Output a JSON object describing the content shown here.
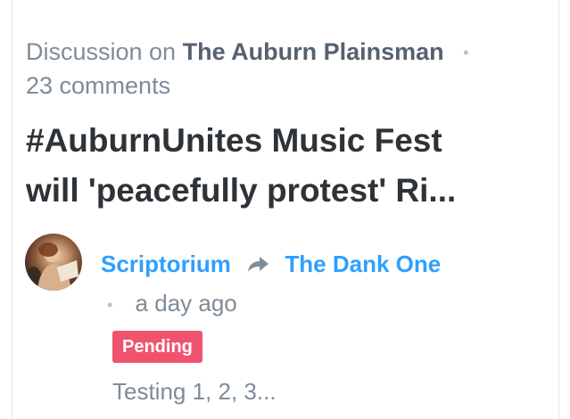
{
  "discussion": {
    "prefix": "Discussion on",
    "forum_name": "The Auburn Plainsman",
    "separator": "•",
    "comment_count": "23 comments"
  },
  "thread": {
    "title_line1": "#AuburnUnites Music Fest",
    "title_line2": "will 'peacefully protest' Ri..."
  },
  "comment": {
    "author": "Scriptorium",
    "reply_icon": "reply-arrow-icon",
    "reply_to": "The Dank One",
    "separator": "•",
    "timestamp": "a day ago",
    "status_badge": "Pending",
    "text": "Testing 1, 2, 3..."
  },
  "colors": {
    "link": "#2e9fff",
    "muted": "#7f8c98",
    "title": "#2e3338",
    "forum": "#556270",
    "badge": "#f0536e"
  }
}
